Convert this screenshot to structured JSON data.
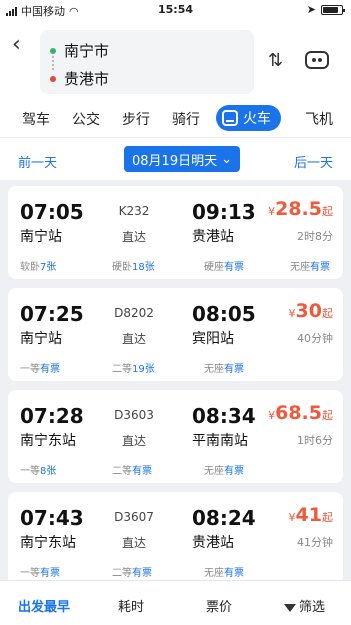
{
  "status_bar": {
    "carrier": "中国移动",
    "time": "15:54"
  },
  "route": {
    "from": "南宁市",
    "to": "贵港市"
  },
  "modes": [
    "驾车",
    "公交",
    "步行",
    "骑行",
    "火车",
    "飞机"
  ],
  "active_mode": "火车",
  "date_bar": {
    "prev": "前一天",
    "date": "08月19日明天",
    "next": "后一天"
  },
  "trains": [
    {
      "dep_time": "07:05",
      "dep_station": "南宁站",
      "train_no": "K232",
      "type": "直达",
      "arr_time": "09:13",
      "arr_station": "贵港站",
      "price_cur": "¥",
      "price": "28.5",
      "price_suffix": "起",
      "duration": "2时8分",
      "seats": [
        {
          "name": "软卧",
          "status": "7张"
        },
        {
          "name": "硬卧",
          "status": "18张"
        },
        {
          "name": "硬座",
          "status": "有票"
        },
        {
          "name": "无座",
          "status": "有票"
        }
      ]
    },
    {
      "dep_time": "07:25",
      "dep_station": "南宁站",
      "train_no": "D8202",
      "type": "直达",
      "arr_time": "08:05",
      "arr_station": "宾阳站",
      "price_cur": "¥",
      "price": "30",
      "price_suffix": "起",
      "duration": "40分钟",
      "seats": [
        {
          "name": "一等",
          "status": "有票"
        },
        {
          "name": "二等",
          "status": "19张"
        },
        {
          "name": "无座",
          "status": "有票"
        }
      ]
    },
    {
      "dep_time": "07:28",
      "dep_station": "南宁东站",
      "train_no": "D3603",
      "type": "直达",
      "arr_time": "08:34",
      "arr_station": "平南南站",
      "price_cur": "¥",
      "price": "68.5",
      "price_suffix": "起",
      "duration": "1时6分",
      "seats": [
        {
          "name": "一等",
          "status": "8张"
        },
        {
          "name": "二等",
          "status": "有票"
        },
        {
          "name": "无座",
          "status": "有票"
        }
      ]
    },
    {
      "dep_time": "07:43",
      "dep_station": "南宁东站",
      "train_no": "D3607",
      "type": "直达",
      "arr_time": "08:24",
      "arr_station": "贵港站",
      "price_cur": "¥",
      "price": "41",
      "price_suffix": "起",
      "duration": "41分钟",
      "seats": [
        {
          "name": "一等",
          "status": "有票"
        },
        {
          "name": "二等",
          "status": "有票"
        },
        {
          "name": "无座",
          "status": "有票"
        }
      ]
    }
  ],
  "bottom_bar": {
    "sort_earliest": "出发最早",
    "sort_duration": "耗时",
    "sort_price": "票价",
    "filter": "筛选"
  },
  "colors": {
    "accent": "#1a73e8",
    "price": "#f05a3a"
  }
}
